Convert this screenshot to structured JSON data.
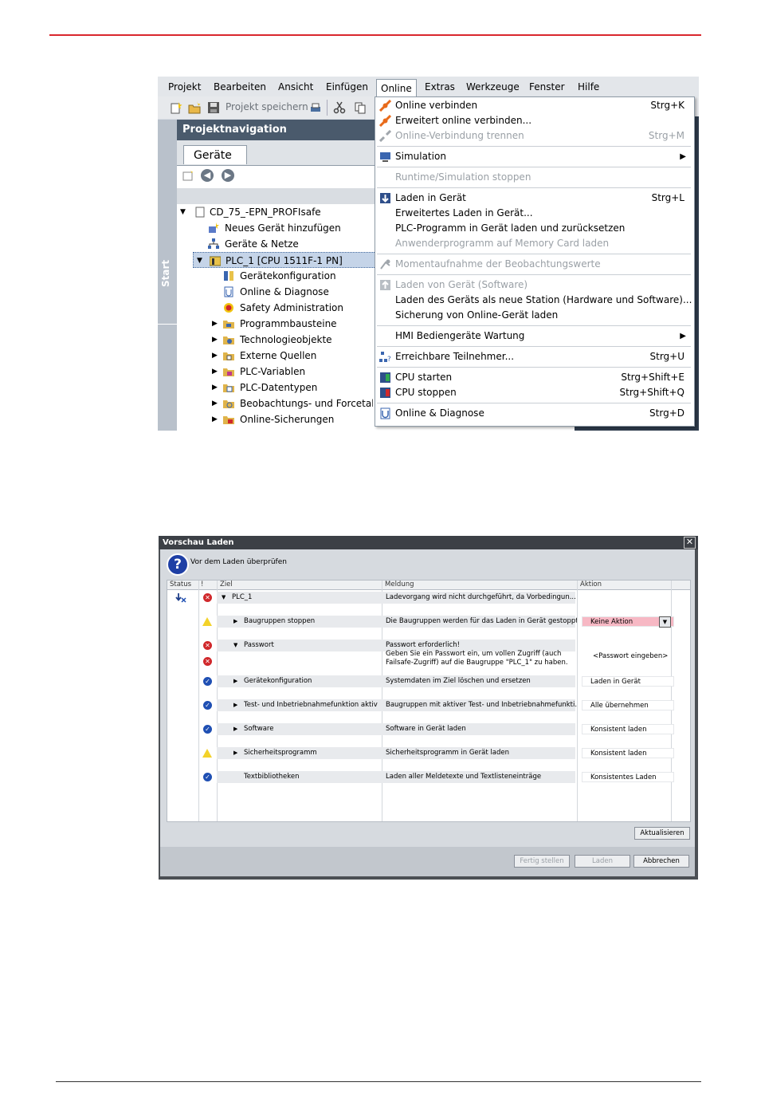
{
  "menubar": {
    "items": [
      "Projekt",
      "Bearbeiten",
      "Ansicht",
      "Einfügen",
      "Online",
      "Extras",
      "Werkzeuge",
      "Fenster",
      "Hilfe"
    ]
  },
  "toolbar": {
    "save_label": "Projekt speichern"
  },
  "sidebar": {
    "start_label": "Start"
  },
  "projnav": {
    "title": "Projektnavigation",
    "tab": "Geräte",
    "tree": [
      "CD_75_-EPN_PROFIsafe",
      "Neues Gerät hinzufügen",
      "Geräte & Netze",
      "PLC_1 [CPU 1511F-1 PN]",
      "Gerätekonfiguration",
      "Online & Diagnose",
      "Safety Administration",
      "Programmbausteine",
      "Technologieobjekte",
      "Externe Quellen",
      "PLC-Variablen",
      "PLC-Datentypen",
      "Beobachtungs- und Forcetabe",
      "Online-Sicherungen"
    ]
  },
  "online_menu": [
    {
      "label": "Online verbinden",
      "shortcut": "Strg+K"
    },
    {
      "label": "Erweitert online verbinden...",
      "shortcut": ""
    },
    {
      "label": "Online-Verbindung trennen",
      "shortcut": "Strg+M"
    },
    {
      "label": "Simulation",
      "shortcut": ""
    },
    {
      "label": "Runtime/Simulation stoppen",
      "shortcut": ""
    },
    {
      "label": "Laden in Gerät",
      "shortcut": "Strg+L"
    },
    {
      "label": "Erweitertes Laden in Gerät...",
      "shortcut": ""
    },
    {
      "label": "PLC-Programm in Gerät laden und zurücksetzen",
      "shortcut": ""
    },
    {
      "label": "Anwenderprogramm auf Memory Card laden",
      "shortcut": ""
    },
    {
      "label": "Momentaufnahme der Beobachtungswerte",
      "shortcut": ""
    },
    {
      "label": "Laden von Gerät (Software)",
      "shortcut": ""
    },
    {
      "label": "Laden des Geräts als neue Station (Hardware und Software)...",
      "shortcut": ""
    },
    {
      "label": "Sicherung von Online-Gerät laden",
      "shortcut": ""
    },
    {
      "label": "HMI Bediengeräte Wartung",
      "shortcut": ""
    },
    {
      "label": "Erreichbare Teilnehmer...",
      "shortcut": "Strg+U"
    },
    {
      "label": "CPU starten",
      "shortcut": "Strg+Shift+E"
    },
    {
      "label": "CPU stoppen",
      "shortcut": "Strg+Shift+Q"
    },
    {
      "label": "Online & Diagnose",
      "shortcut": "Strg+D"
    }
  ],
  "dialog": {
    "title": "Vorschau Laden",
    "subtitle": "Vor dem Laden überprüfen",
    "headers": {
      "status": "Status",
      "info": "!",
      "ziel": "Ziel",
      "meldung": "Meldung",
      "aktion": "Aktion"
    },
    "rows": [
      {
        "ziel": "PLC_1",
        "meldung": "Ladevorgang wird nicht durchgeführt, da Vorbedingun...",
        "aktion": ""
      },
      {
        "ziel": "Baugruppen stoppen",
        "meldung": "Die Baugruppen werden für das Laden in Gerät gestoppt",
        "aktion": "Keine Aktion"
      },
      {
        "ziel": "Passwort",
        "meldung": "Passwort erforderlich!",
        "aktion": ""
      },
      {
        "ziel": "",
        "meldung": "Geben Sie ein Passwort ein, um vollen Zugriff (auch",
        "meldung2": "Failsafe-Zugriff) auf die Baugruppe \"PLC_1\" zu haben.",
        "aktion": "<Passwort eingeben>"
      },
      {
        "ziel": "Gerätekonfiguration",
        "meldung": "Systemdaten im Ziel löschen und ersetzen",
        "aktion": "Laden in Gerät"
      },
      {
        "ziel": "Test- und Inbetriebnahmefunktion aktiv",
        "meldung": "Baugruppen mit aktiver Test- und Inbetriebnahmefunkti...",
        "aktion": "Alle übernehmen"
      },
      {
        "ziel": "Software",
        "meldung": "Software in Gerät laden",
        "aktion": "Konsistent laden"
      },
      {
        "ziel": "Sicherheitsprogramm",
        "meldung": "Sicherheitsprogramm in Gerät laden",
        "aktion": "Konsistent laden"
      },
      {
        "ziel": "Textbibliotheken",
        "meldung": "Laden aller Meldetexte und Textlisteneinträge",
        "aktion": "Konsistentes Laden"
      }
    ],
    "refresh_label": "Aktualisieren",
    "finish_label": "Fertig stellen",
    "load_label": "Laden",
    "cancel_label": "Abbrechen"
  },
  "colors": {
    "accent_red": "#d9272e",
    "nav_title": "#4a5a6c",
    "error": "#d0282b",
    "ok": "#1f4fb3",
    "warn": "#f3d22a"
  }
}
